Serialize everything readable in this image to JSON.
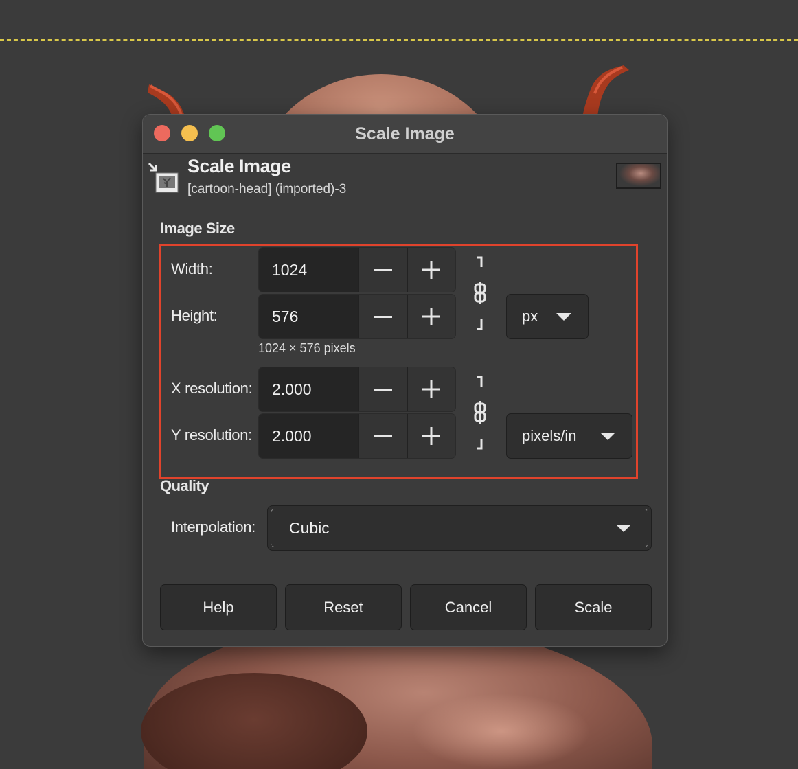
{
  "dialog": {
    "window_title": "Scale Image",
    "header_title": "Scale Image",
    "header_subtitle": "[cartoon-head] (imported)-3"
  },
  "image_size": {
    "section_label": "Image Size",
    "width_label": "Width:",
    "width_value": "1024",
    "height_label": "Height:",
    "height_value": "576",
    "size_unit": "px",
    "pixels_info": "1024 × 576 pixels",
    "x_res_label": "X resolution:",
    "x_res_value": "2.000",
    "y_res_label": "Y resolution:",
    "y_res_value": "2.000",
    "res_unit": "pixels/in"
  },
  "quality": {
    "section_label": "Quality",
    "interpolation_label": "Interpolation:",
    "interpolation_value": "Cubic"
  },
  "buttons": {
    "help": "Help",
    "reset": "Reset",
    "cancel": "Cancel",
    "scale": "Scale"
  },
  "colors": {
    "highlight": "#e0432c",
    "close": "#ed6a5e",
    "minimize": "#f5bf4f",
    "maximize": "#61c554"
  }
}
